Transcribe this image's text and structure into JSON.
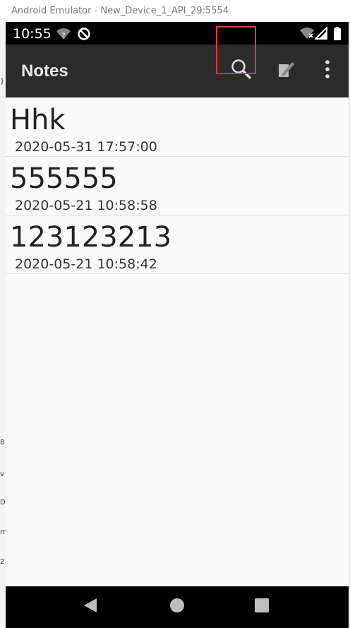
{
  "window": {
    "title": "Android Emulator - New_Device_1_API_29:5554"
  },
  "status_bar": {
    "time": "10:55",
    "icons": [
      "wifi-question-icon",
      "data-saver-icon",
      "wifi-off-icon",
      "signal-icon",
      "battery-icon"
    ]
  },
  "app_bar": {
    "title": "Notes",
    "actions": [
      "search-icon",
      "edit-note-icon",
      "overflow-menu-icon"
    ]
  },
  "notes": [
    {
      "title": "Hhk",
      "date": "2020-05-31 17:57:00"
    },
    {
      "title": "555555",
      "date": "2020-05-21 10:58:58"
    },
    {
      "title": "123123213",
      "date": "2020-05-21 10:58:42"
    }
  ],
  "background_fragments": [
    "}",
    "8",
    "v",
    "D",
    "m",
    "2"
  ],
  "nav_bar": {
    "buttons": [
      "back-icon",
      "home-icon",
      "recents-icon"
    ]
  },
  "colors": {
    "app_bar": "#2b2b2b",
    "highlight": "#e53935",
    "list_bg": "#fafafa"
  }
}
